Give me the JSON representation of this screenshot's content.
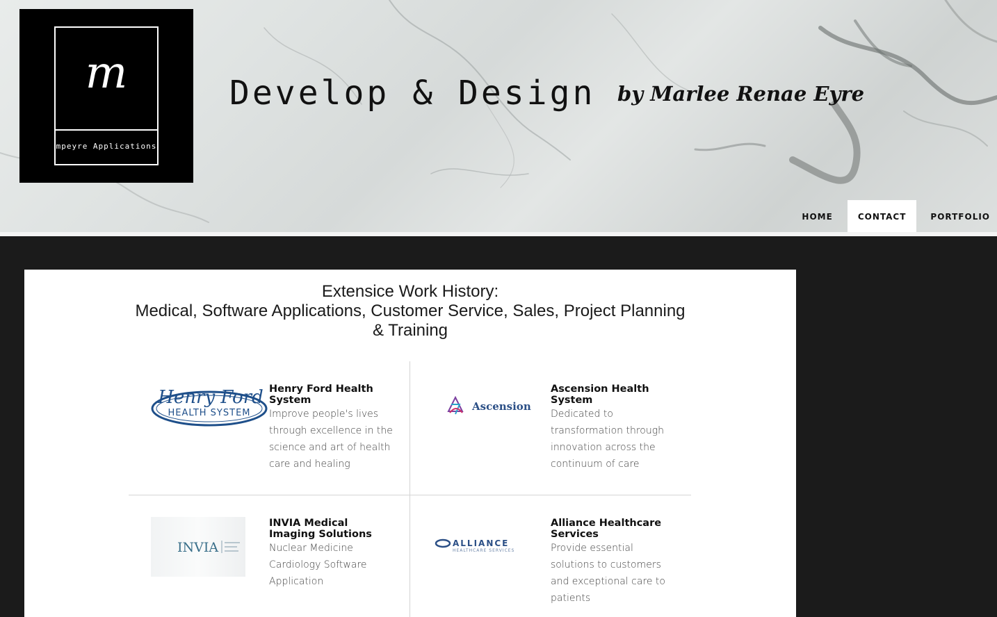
{
  "header": {
    "logo": {
      "mark": "m",
      "caption": "mpeyre Applications"
    },
    "title": "Develop & Design",
    "byline": "by Marlee Renae Eyre"
  },
  "nav": {
    "items": [
      {
        "label": "HOME",
        "active": false
      },
      {
        "label": "CONTACT",
        "active": true
      },
      {
        "label": "PORTFOLIO",
        "active": false
      }
    ]
  },
  "main": {
    "heading_line1": "Extensice Work History:",
    "heading_line2": "Medical, Software Applications, Customer Service, Sales, Project Planning & Training",
    "employers": [
      {
        "name": "Henry Ford Health System",
        "logo_text": "Henry Ford",
        "logo_subtext": "HEALTH SYSTEM",
        "description": "Improve people's lives through excellence in the science and art of health care and healing"
      },
      {
        "name": "Ascension Health System",
        "logo_text": "Ascension",
        "description": "Dedicated to transformation through innovation across the continuum of care"
      },
      {
        "name": "INVIA Medical Imaging Solutions",
        "logo_text": "INVIA",
        "description": "Nuclear Medicine Cardiology Software Application"
      },
      {
        "name": "Alliance Healthcare Services",
        "logo_text": "ALLIANCE",
        "logo_subtext": "HEALTHCARE SERVICES",
        "description": "Provide essential solutions to customers and exceptional care to patients"
      }
    ]
  },
  "colors": {
    "page_bg": "#1b1b1b",
    "card_bg": "#ffffff",
    "henry_ford_blue": "#1e4f8a",
    "ascension_blue": "#2b4f86",
    "invia_teal": "#3a6f8a"
  }
}
